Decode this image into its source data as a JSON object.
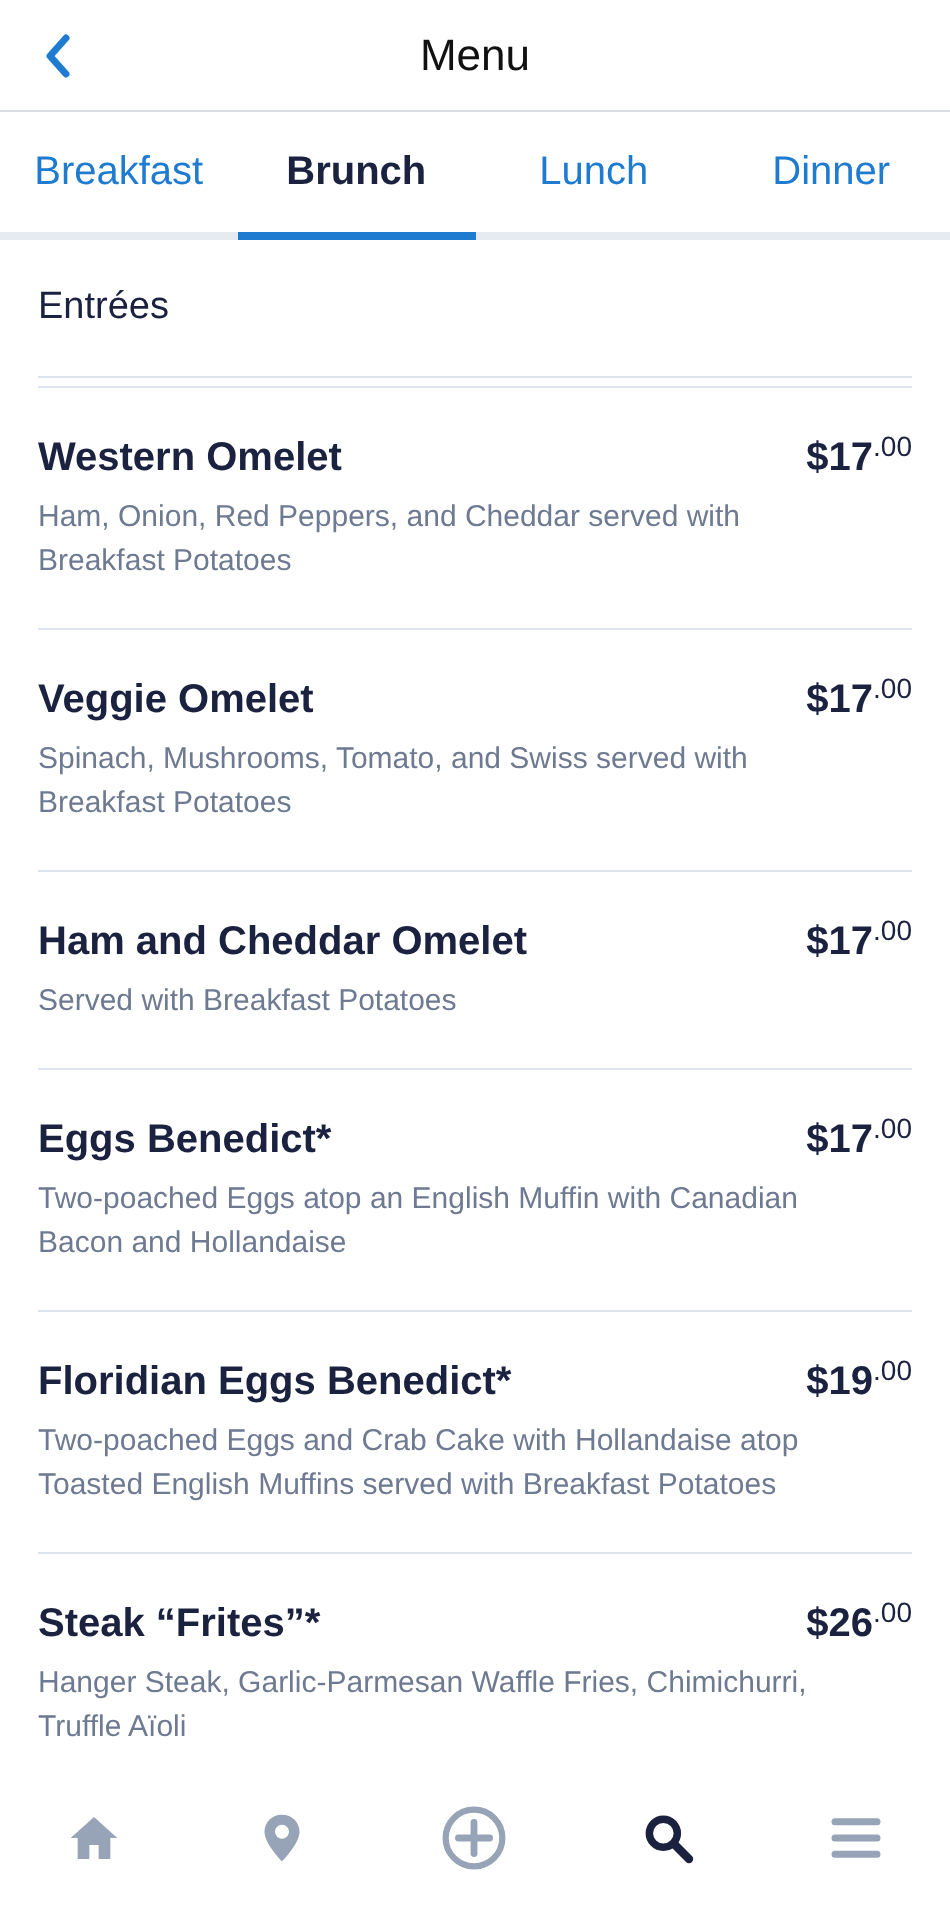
{
  "header": {
    "title": "Menu"
  },
  "tabs": [
    {
      "label": "Breakfast",
      "selected": false
    },
    {
      "label": "Brunch",
      "selected": true
    },
    {
      "label": "Lunch",
      "selected": false
    },
    {
      "label": "Dinner",
      "selected": false
    }
  ],
  "section": {
    "title": "Entrées"
  },
  "items": [
    {
      "name": "Western Omelet",
      "price": "$17$^{.00}$",
      "description": "Ham, Onion, Red Peppers, and Cheddar served with Breakfast Potatoes"
    },
    {
      "name": "Veggie Omelet",
      "price": "$17$^{.00}$",
      "description": "Spinach, Mushrooms, Tomato, and Swiss served with Breakfast Potatoes"
    },
    {
      "name": "Ham and Cheddar Omelet",
      "price": "$17$^{.00}$",
      "description": "Served with Breakfast Potatoes"
    },
    {
      "name": "Eggs Benedict*",
      "price": "$17$^{.00}$",
      "description": "Two-poached Eggs atop an English Muffin with Canadian Bacon and Hollandaise"
    },
    {
      "name": "Floridian Eggs Benedict*",
      "price": "$19$^{.00}$",
      "description": "Two-poached Eggs and Crab Cake with Hollandaise atop Toasted English Muffins served with Breakfast Potatoes"
    },
    {
      "name": "Steak “Frites”*",
      "price": "$26$^{.00}$",
      "description": "Hanger Steak, Garlic-Parmesan Waffle Fries, Chimichurri, Truffle Aïoli"
    }
  ],
  "nav": [
    {
      "kind": "home",
      "selected": false
    },
    {
      "kind": "location",
      "selected": false
    },
    {
      "kind": "add",
      "selected": false
    },
    {
      "kind": "search",
      "selected": true
    },
    {
      "kind": "menu",
      "selected": false
    }
  ]
}
